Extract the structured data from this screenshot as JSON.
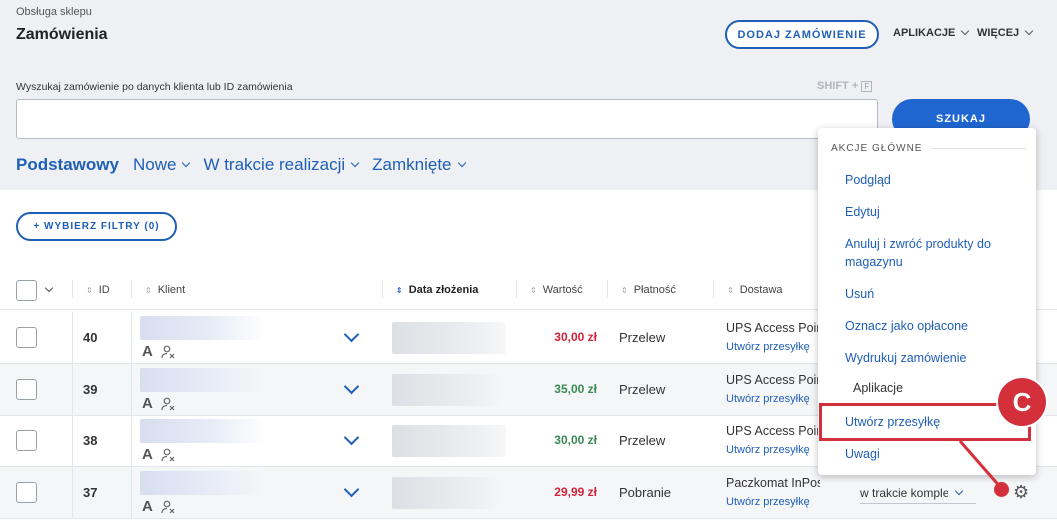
{
  "breadcrumb": "Obsługa sklepu",
  "page_title": "Zamówienia",
  "header": {
    "add_order": "DODAJ ZAMÓWIENIE",
    "apps": "APLIKACJE",
    "more": "WIĘCEJ"
  },
  "search": {
    "label": "Wyszukaj zamówienie po danych klienta lub ID zamówienia",
    "shortcut": "SHIFT +",
    "shortcut_key": "F",
    "button": "SZUKAJ",
    "value": ""
  },
  "tabs": [
    {
      "label": "Podstawowy"
    },
    {
      "label": "Nowe"
    },
    {
      "label": "W trakcie realizacji"
    },
    {
      "label": "Zamknięte"
    }
  ],
  "filters_button": "+ WYBIERZ FILTRY (0)",
  "columns": {
    "id": "ID",
    "client": "Klient",
    "date": "Data złożenia",
    "value": "Wartość",
    "payment": "Płatność",
    "delivery": "Dostawa"
  },
  "rows": [
    {
      "id": "40",
      "value": "30,00 zł",
      "value_color": "#d0233b",
      "payment": "Przelew",
      "delivery": "UPS Access Point",
      "delivery_link": "Utwórz przesyłkę"
    },
    {
      "id": "39",
      "value": "35,00 zł",
      "value_color": "#3a8a55",
      "payment": "Przelew",
      "delivery": "UPS Access Point",
      "delivery_link": "Utwórz przesyłkę"
    },
    {
      "id": "38",
      "value": "30,00 zł",
      "value_color": "#3a8a55",
      "payment": "Przelew",
      "delivery": "UPS Access Point",
      "delivery_link": "Utwórz przesyłkę"
    },
    {
      "id": "37",
      "value": "29,99 zł",
      "value_color": "#d0233b",
      "payment": "Pobranie",
      "delivery": "Paczkomat InPost",
      "delivery_link": "Utwórz przesyłkę",
      "status": "w trakcie kompletowania"
    }
  ],
  "dropdown": {
    "heading": "AKCJE GŁÓWNE",
    "items": [
      "Podgląd",
      "Edytuj",
      "Anuluj i zwróć produkty do magazynu",
      "Usuń",
      "Oznacz jako opłacone",
      "Wydrukuj zamówienie"
    ],
    "sub_heading": "Aplikacje",
    "app_items": [
      "Utwórz przesyłkę",
      "Uwagi"
    ]
  },
  "annotation": {
    "badge": "C",
    "color": "#d4303c"
  },
  "icons": {
    "client_type": "A",
    "client_icon": "user-x-icon",
    "settings": "gear-icon"
  }
}
